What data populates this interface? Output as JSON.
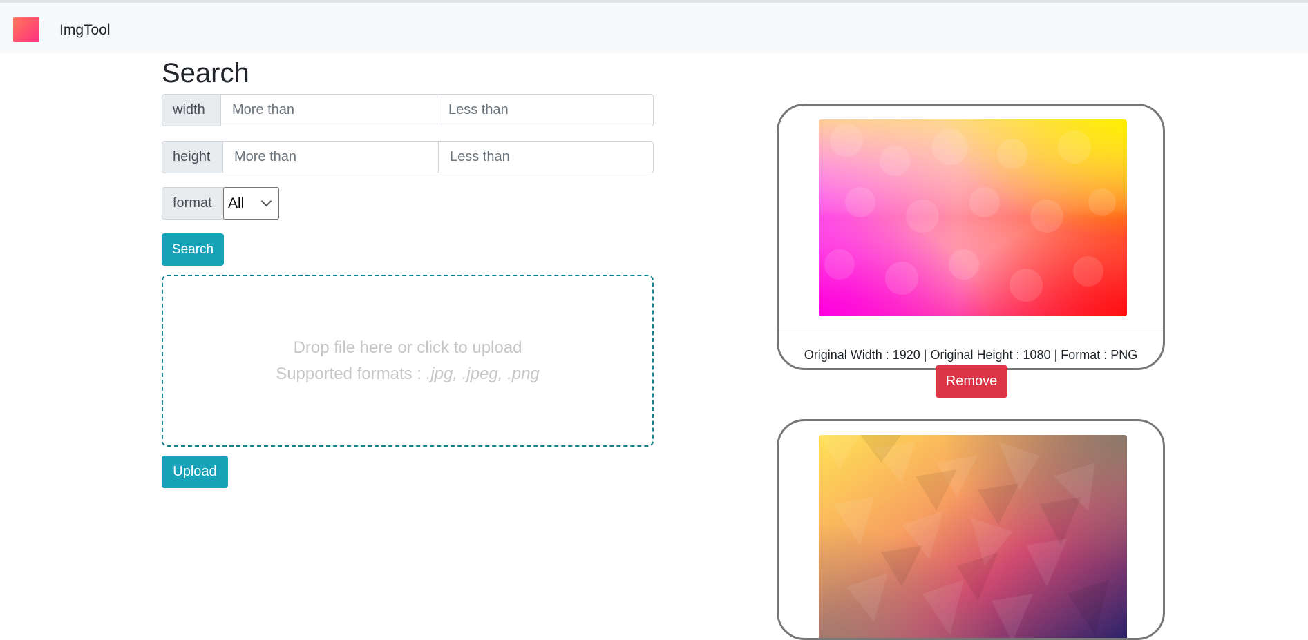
{
  "navbar": {
    "brand": "ImgTool",
    "logo_icon": "gradient-square-logo"
  },
  "search": {
    "title": "Search",
    "width": {
      "label": "width",
      "min_placeholder": "More than",
      "max_placeholder": "Less than",
      "min_value": "",
      "max_value": ""
    },
    "height": {
      "label": "height",
      "min_placeholder": "More than",
      "max_placeholder": "Less than",
      "min_value": "",
      "max_value": ""
    },
    "format": {
      "label": "format",
      "selected": "All"
    },
    "search_button": "Search"
  },
  "upload": {
    "drop_line1": "Drop file here or click to upload",
    "drop_line2_prefix": "Supported formats : ",
    "drop_line2_formats": ".jpg, .jpeg, .png",
    "upload_button": "Upload"
  },
  "images": [
    {
      "info": "Original Width : 1920 | Original Height : 1080 | Format : PNG",
      "remove_label": "Remove"
    },
    {
      "info": "",
      "remove_label": ""
    }
  ],
  "colors": {
    "accent": "#17a2b8",
    "danger": "#dc3545",
    "dropzone_border": "#18808f"
  }
}
